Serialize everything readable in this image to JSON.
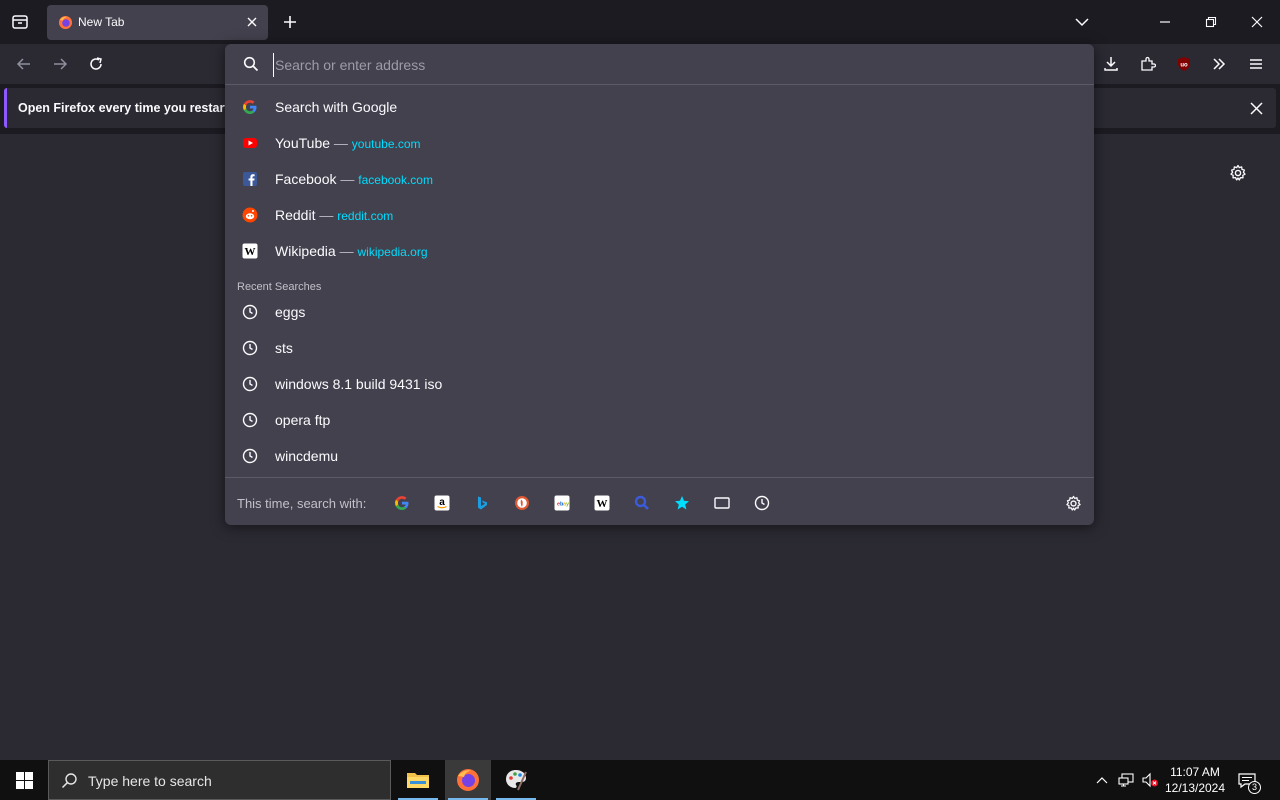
{
  "tab": {
    "title": "New Tab"
  },
  "urlbar": {
    "placeholder": "Search or enter address"
  },
  "notification": {
    "message": "Open Firefox every time you restart y"
  },
  "suggestions": [
    {
      "label": "Search with Google",
      "icon": "google-icon"
    },
    {
      "label": "YouTube",
      "url": "youtube.com",
      "icon": "youtube-icon"
    },
    {
      "label": "Facebook",
      "url": "facebook.com",
      "icon": "facebook-icon"
    },
    {
      "label": "Reddit",
      "url": "reddit.com",
      "icon": "reddit-icon"
    },
    {
      "label": "Wikipedia",
      "url": "wikipedia.org",
      "icon": "wikipedia-icon"
    }
  ],
  "separator": "—",
  "recent": {
    "heading": "Recent Searches",
    "items": [
      "eggs",
      "sts",
      "windows 8.1 build 9431 iso",
      "opera ftp",
      "wincdemu"
    ]
  },
  "footer": {
    "label": "This time, search with:",
    "engines": [
      "google-icon",
      "amazon-icon",
      "bing-icon",
      "duckduckgo-icon",
      "ebay-icon",
      "wikipedia-icon",
      "search-icon",
      "bookmarks-icon",
      "tabs-icon",
      "history-icon"
    ]
  },
  "taskbar": {
    "search_placeholder": "Type here to search",
    "time": "11:07 AM",
    "date": "12/13/2024",
    "notification_count": "3"
  },
  "colors": {
    "accent": "#00ddff",
    "panel": "#42414d",
    "toolbar": "#2b2a33",
    "titlebar": "#1c1b22"
  }
}
